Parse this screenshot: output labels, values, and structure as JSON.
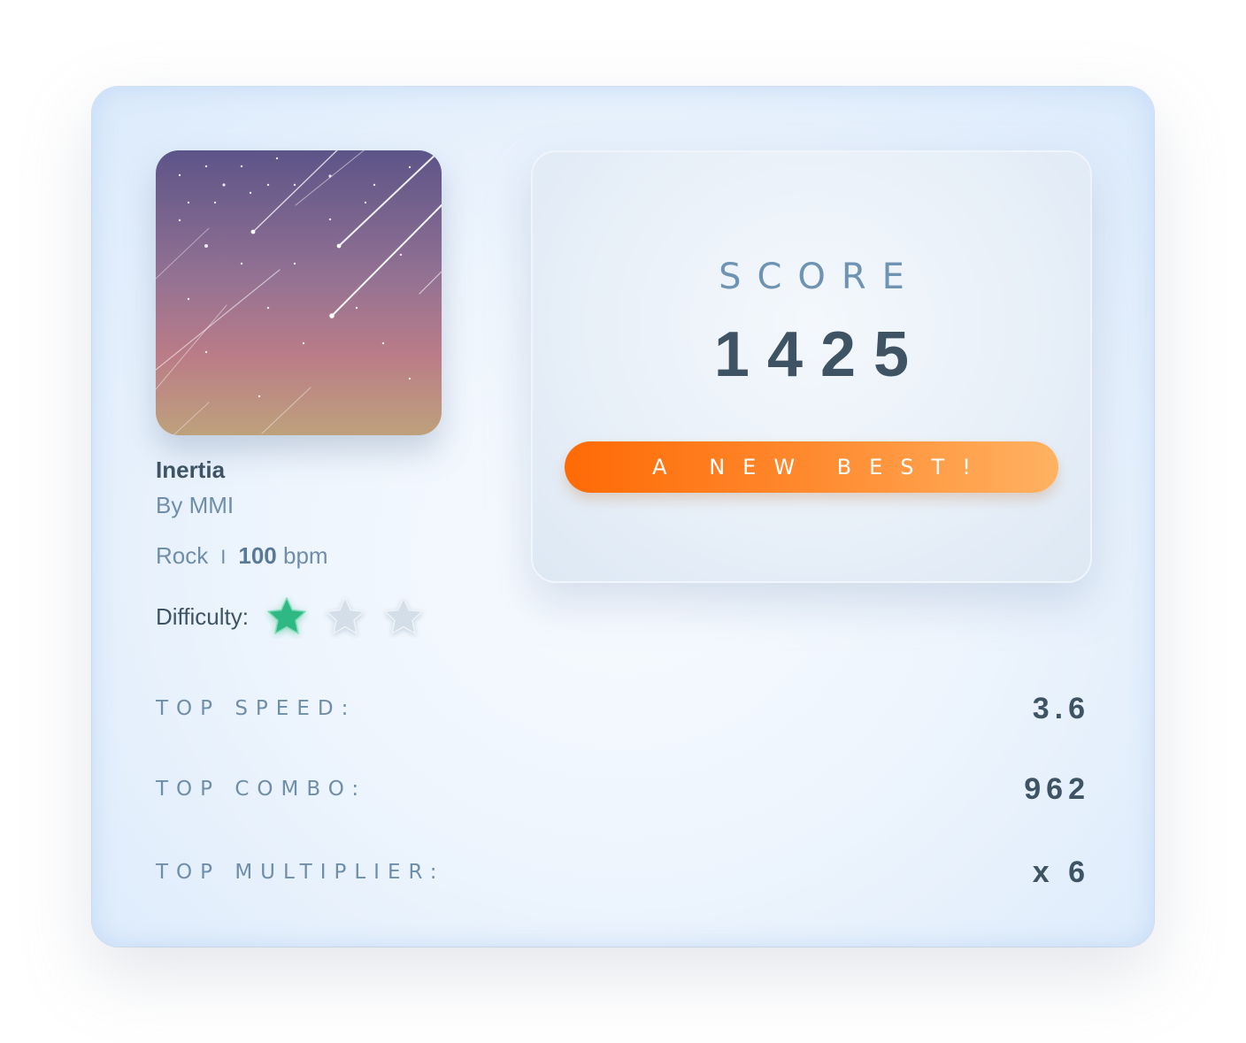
{
  "song": {
    "title": "Inertia",
    "artist": "By MMI",
    "genre": "Rock",
    "separator": "I",
    "bpm_value": "100",
    "bpm_unit": "bpm"
  },
  "difficulty": {
    "label": "Difficulty:",
    "rating": 1,
    "max": 3,
    "active_color": "#2eb884",
    "inactive_color": "#d3dee8"
  },
  "score": {
    "label": "SCORE",
    "value": "1425",
    "best_label": "A NEW BEST!"
  },
  "stats": [
    {
      "label": "TOP SPEED:",
      "value": "3.6"
    },
    {
      "label": "TOP COMBO:",
      "value": "962"
    },
    {
      "label": "TOP MULTIPLIER:",
      "value": "x 6"
    }
  ],
  "colors": {
    "accent": "#ff7a1a",
    "text_dark": "#3e5363",
    "text_muted": "#6f8ea9"
  }
}
